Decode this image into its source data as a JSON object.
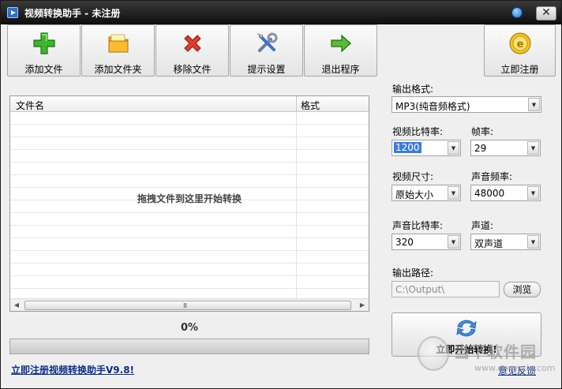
{
  "window": {
    "title": "视频转换助手 - 未注册",
    "close_label": "✕"
  },
  "toolbar": {
    "buttons": [
      {
        "label": "添加文件",
        "icon": "plus-icon"
      },
      {
        "label": "添加文件夹",
        "icon": "folder-icon"
      },
      {
        "label": "移除文件",
        "icon": "remove-x-icon"
      },
      {
        "label": "提示设置",
        "icon": "tools-icon"
      },
      {
        "label": "退出程序",
        "icon": "exit-arrow-icon"
      }
    ],
    "register": {
      "label": "立即注册",
      "icon": "coin-icon"
    }
  },
  "file_list": {
    "columns": [
      "文件名",
      "格式"
    ],
    "rows": [],
    "empty_hint": "拖拽文件到这里开始转换",
    "scroll_grip": "III"
  },
  "progress": {
    "text": "0%",
    "value": 0
  },
  "register_link": "立即注册视频转换助手V9.8!",
  "settings": {
    "output_format_label": "输出格式:",
    "output_format_value": "MP3(纯音频格式)",
    "video_bitrate_label": "视频比特率:",
    "video_bitrate_value": "1200",
    "frame_rate_label": "帧率:",
    "frame_rate_value": "29",
    "video_size_label": "视频尺寸:",
    "video_size_value": "原始大小",
    "audio_sample_label": "声音频率:",
    "audio_sample_value": "48000",
    "audio_bitrate_label": "声音比特率:",
    "audio_bitrate_value": "320",
    "channel_label": "声道:",
    "channel_value": "双声道",
    "output_path_label": "输出路径:",
    "output_path_value": "C:\\Output\\",
    "browse_label": "浏览"
  },
  "start_button": {
    "label": "立即开始转换!",
    "icon": "convert-icon"
  },
  "feedback_link": "意见反馈",
  "watermark": {
    "text": "当下软件园",
    "url": "www.downxia.com"
  },
  "colors": {
    "titlebar": "#1a1a1a",
    "link": "#0b2f8a",
    "selection": "#3b7ce0",
    "progress_fill": "#4ea52f"
  }
}
